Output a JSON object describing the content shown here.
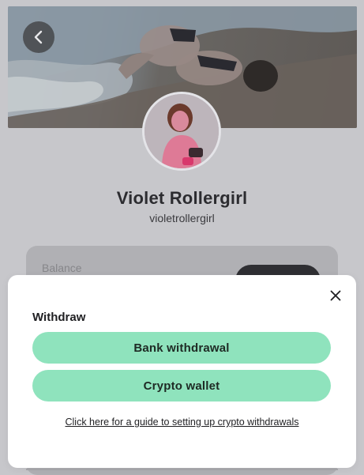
{
  "profile": {
    "display_name": "Violet Rollergirl",
    "username": "violetrollergirl"
  },
  "balance_card": {
    "label": "Balance"
  },
  "withdraw_modal": {
    "title": "Withdraw",
    "options": [
      {
        "label": "Bank withdrawal"
      },
      {
        "label": "Crypto wallet"
      }
    ],
    "guide_link": "Click here for a guide to setting up crypto withdrawals"
  },
  "icons": {
    "back": "chevron-left-icon",
    "close": "close-icon"
  },
  "colors": {
    "backdrop": "#c7c7cb",
    "modal_bg": "#ffffff",
    "option_button": "#8fe3bd",
    "card_bg": "#b0b0b4",
    "dark_button": "#2f2f33"
  }
}
